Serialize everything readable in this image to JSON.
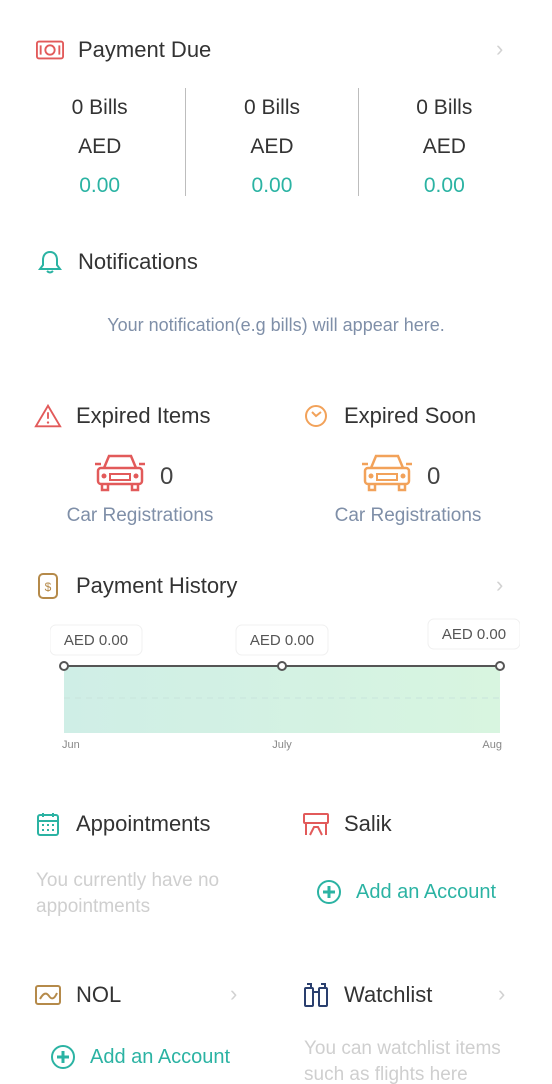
{
  "payment_due": {
    "title": "Payment Due",
    "columns": [
      {
        "bills": "0 Bills",
        "currency": "AED",
        "amount": "0.00"
      },
      {
        "bills": "0 Bills",
        "currency": "AED",
        "amount": "0.00"
      },
      {
        "bills": "0 Bills",
        "currency": "AED",
        "amount": "0.00"
      }
    ]
  },
  "notifications": {
    "title": "Notifications",
    "empty_text": "Your notification(e.g bills) will appear here."
  },
  "expired_items": {
    "title": "Expired Items",
    "count": "0",
    "label": "Car Registrations",
    "color": "#e25a5a"
  },
  "expired_soon": {
    "title": "Expired Soon",
    "count": "0",
    "label": "Car Registrations",
    "color": "#f2a25a"
  },
  "payment_history": {
    "title": "Payment History",
    "chart_data": {
      "type": "area",
      "x": [
        "Jun",
        "July",
        "Aug"
      ],
      "values": [
        0,
        0,
        0
      ],
      "data_labels": [
        "AED 0.00",
        "AED 0.00",
        "AED 0.00"
      ]
    }
  },
  "appointments": {
    "title": "Appointments",
    "empty_text": "You currently have no appointments"
  },
  "salik": {
    "title": "Salik",
    "add_label": "Add an Account"
  },
  "nol": {
    "title": "NOL",
    "add_label": "Add an Account"
  },
  "watchlist": {
    "title": "Watchlist",
    "empty_text": "You can watchlist items such as flights here"
  },
  "colors": {
    "teal": "#2bb3a3",
    "red": "#e25a5a",
    "orange": "#f2a25a",
    "gold": "#b58a4a"
  }
}
